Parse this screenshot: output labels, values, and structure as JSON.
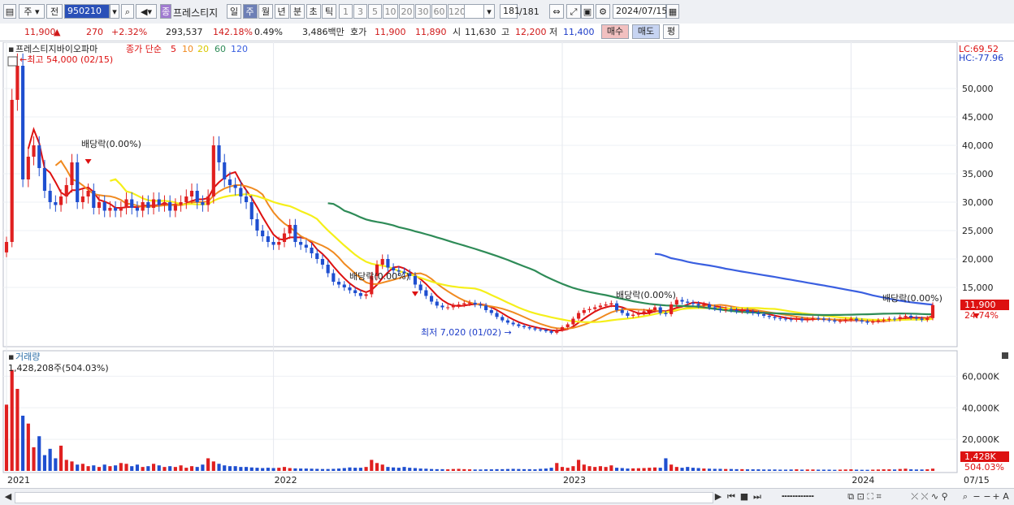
{
  "toolbar": {
    "period_unit": "주",
    "prev_label": "전",
    "code": "950210",
    "name_badge": "종",
    "stock_name": "프레스티지",
    "tabs": [
      "일",
      "주",
      "월",
      "년",
      "분",
      "초",
      "틱"
    ],
    "active_tab": 1,
    "intervals": [
      "1",
      "3",
      "5",
      "10",
      "20",
      "30",
      "60",
      "120"
    ],
    "count": "181",
    "count_total": "/181",
    "date": "2024/07/15"
  },
  "quote": {
    "price": "11,900",
    "change": "270",
    "change_pct": "+2.32%",
    "volume": "293,537",
    "volume_ratio": "142.18%",
    "turnover": "0.49%",
    "amount": "3,486백만",
    "bid_label": "호가",
    "bid1": "11,900",
    "bid2": "11,890",
    "open_label": "시",
    "open": "11,630",
    "high_label": "고",
    "high": "12,200",
    "low_label": "저",
    "low": "11,400",
    "buy_label": "매수",
    "sell_label": "매도",
    "avg_label": "평"
  },
  "legend": {
    "company": "프레스티지바이오파마",
    "ma_label": "종가 단순",
    "periods": [
      "5",
      "10",
      "20",
      "60",
      "120"
    ],
    "lc": "LC:69.52",
    "hc": "HC:-77.96"
  },
  "annotations": {
    "max_label": "최고 54,000 (02/15)",
    "min_label": "최저 7,020 (01/02)",
    "dividends": [
      "배당락(0.00%)",
      "배당락(0.00%)",
      "배당락(0.00%)",
      "배당락(0.00%)"
    ],
    "price_tag": "11,900",
    "price_tag_pct": "24.74%"
  },
  "volume_panel": {
    "title": "거래량",
    "current": "1,428,208주(504.03%)",
    "tag": "1,428K",
    "tag_pct": "504.03%"
  },
  "colors": {
    "up": "#e02020",
    "down": "#1f4fd0",
    "ma5": "#dd1111",
    "ma10": "#f08a20",
    "ma20": "#f5ef1a",
    "ma60": "#2e8b57",
    "ma120": "#3a5fe0"
  },
  "chart_data": {
    "type": "candlestick",
    "price_axis": {
      "ylim": [
        5000,
        57000
      ],
      "ticks": [
        15000,
        20000,
        25000,
        30000,
        35000,
        40000,
        45000,
        50000
      ],
      "tick_labels": [
        "15,000",
        "20,000",
        "25,000",
        "30,000",
        "35,000",
        "40,000",
        "45,000",
        "50,000"
      ]
    },
    "volume_axis": {
      "ylim": [
        0,
        70000
      ],
      "ticks": [
        20000,
        40000,
        60000
      ],
      "tick_labels": [
        "20,000K",
        "40,000K",
        "60,000K"
      ]
    },
    "x_labels": [
      "2021",
      "2022",
      "2023",
      "2024",
      "07/15"
    ],
    "weekly_close": [
      23000,
      48000,
      54000,
      34000,
      38000,
      40000,
      36000,
      32000,
      30000,
      29500,
      31000,
      33000,
      37000,
      30000,
      31000,
      32000,
      29000,
      30000,
      28500,
      29000,
      28500,
      29000,
      30500,
      29000,
      28500,
      30000,
      29000,
      30500,
      29500,
      30000,
      28500,
      29500,
      30000,
      31000,
      32000,
      30000,
      29500,
      31000,
      40000,
      37000,
      34000,
      33000,
      32500,
      31000,
      30000,
      27000,
      25000,
      24000,
      23000,
      22500,
      23000,
      24500,
      26000,
      23000,
      22500,
      22000,
      21000,
      20000,
      19000,
      17500,
      16000,
      15500,
      15000,
      14500,
      14000,
      13500,
      13800,
      17000,
      19000,
      20000,
      18500,
      18000,
      17800,
      17500,
      17000,
      15500,
      14500,
      13500,
      12500,
      11800,
      11500,
      11500,
      11800,
      12000,
      12200,
      12300,
      12000,
      11800,
      11000,
      10500,
      9800,
      9200,
      8800,
      8500,
      8200,
      8000,
      7800,
      7600,
      7500,
      7300,
      7020,
      7500,
      8000,
      8500,
      9500,
      10500,
      11000,
      11200,
      11500,
      11800,
      12000,
      12200,
      11000,
      10500,
      10000,
      10200,
      10500,
      10800,
      11000,
      11500,
      10500,
      10300,
      12000,
      12800,
      12500,
      12300,
      12100,
      11800,
      12000,
      11500,
      11300,
      11000,
      11200,
      11000,
      10800,
      11000,
      10700,
      10500,
      10300,
      10000,
      9800,
      9600,
      9500,
      9400,
      9300,
      9500,
      9200,
      9400,
      9600,
      9500,
      9300,
      9200,
      9000,
      9100,
      9300,
      9500,
      9200,
      9000,
      8800,
      9000,
      9200,
      9300,
      9500,
      9400,
      9800,
      10000,
      9700,
      9500,
      9300,
      9600,
      11900
    ],
    "series": [
      {
        "name": "5",
        "values": []
      },
      {
        "name": "10",
        "values": []
      },
      {
        "name": "20",
        "values": []
      },
      {
        "name": "60",
        "values": []
      },
      {
        "name": "120",
        "values": []
      }
    ],
    "weekly_volume_k": [
      42000,
      64000,
      52000,
      35000,
      30000,
      15000,
      22000,
      10000,
      14000,
      8000,
      16000,
      7000,
      6000,
      4000,
      4500,
      3000,
      3500,
      2500,
      4000,
      3000,
      3500,
      5000,
      4500,
      3000,
      4000,
      2500,
      3000,
      4500,
      3500,
      2500,
      3000,
      2500,
      3500,
      2000,
      3000,
      2500,
      4000,
      8000,
      6000,
      4500,
      3500,
      3000,
      3000,
      2500,
      2500,
      2200,
      2000,
      1800,
      2000,
      1800,
      2000,
      2500,
      1800,
      1600,
      1500,
      1500,
      1400,
      1300,
      1200,
      1200,
      1300,
      1500,
      1800,
      2200,
      2000,
      2000,
      2500,
      7000,
      5000,
      4000,
      2500,
      2200,
      2000,
      2500,
      2000,
      1800,
      1500,
      1400,
      1200,
      1100,
      1100,
      1000,
      1200,
      1300,
      1100,
      1000,
      900,
      900,
      1000,
      1000,
      1100,
      1100,
      1200,
      1300,
      1200,
      1100,
      1100,
      1000,
      1300,
      1500,
      2000,
      5000,
      2500,
      2000,
      3000,
      7000,
      4000,
      3000,
      2500,
      3000,
      2500,
      3500,
      2000,
      1800,
      1500,
      1600,
      1700,
      1800,
      2000,
      2200,
      2000,
      8000,
      4000,
      2500,
      2000,
      2500,
      2000,
      1800,
      1500,
      1400,
      1300,
      1300,
      1200,
      1200,
      1100,
      1100,
      1000,
      1000,
      1000,
      900,
      900,
      900,
      800,
      800,
      900,
      1000,
      800,
      900,
      900,
      800,
      800,
      800,
      700,
      800,
      900,
      1000,
      800,
      700,
      700,
      800,
      900,
      1000,
      1000,
      900,
      1200,
      1400,
      1000,
      900,
      900,
      1000,
      1428
    ]
  }
}
